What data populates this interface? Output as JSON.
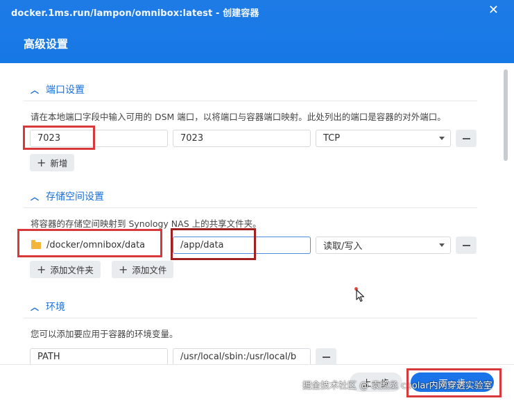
{
  "window": {
    "title": "docker.1ms.run/lampon/omnibox:latest - 创建容器",
    "close": "✕",
    "page_title": "高级设置"
  },
  "ports": {
    "header": "端口设置",
    "description": "请在本地端口字段中输入可用的 DSM 端口，以将端口与容器端口映射。此处列出的端口是容器的对外端口。",
    "local_port": "7023",
    "container_port": "7023",
    "protocol": "TCP",
    "add_label": "新增"
  },
  "storage": {
    "header": "存储空间设置",
    "description": "将容器的存储空间映射到 Synology NAS 上的共享文件夹。",
    "folder": "/docker/omnibox/data",
    "mount_path": "/app/data",
    "permission": "读取/写入",
    "add_folder_label": "添加文件夹",
    "add_file_label": "添加文件"
  },
  "env": {
    "header": "环境",
    "description": "您可以添加要应用于容器的环境变量。",
    "var_name": "PATH",
    "var_value": "/usr/local/sbin:/usr/local/b"
  },
  "footer": {
    "prev_label": "上一步",
    "next_label": "下一步"
  },
  "watermark": "掘金技术社区 @ 袁煦丞 cpolar内网穿透实验室",
  "colors": {
    "accent": "#1a73e8",
    "annotation": "#d9383a"
  }
}
